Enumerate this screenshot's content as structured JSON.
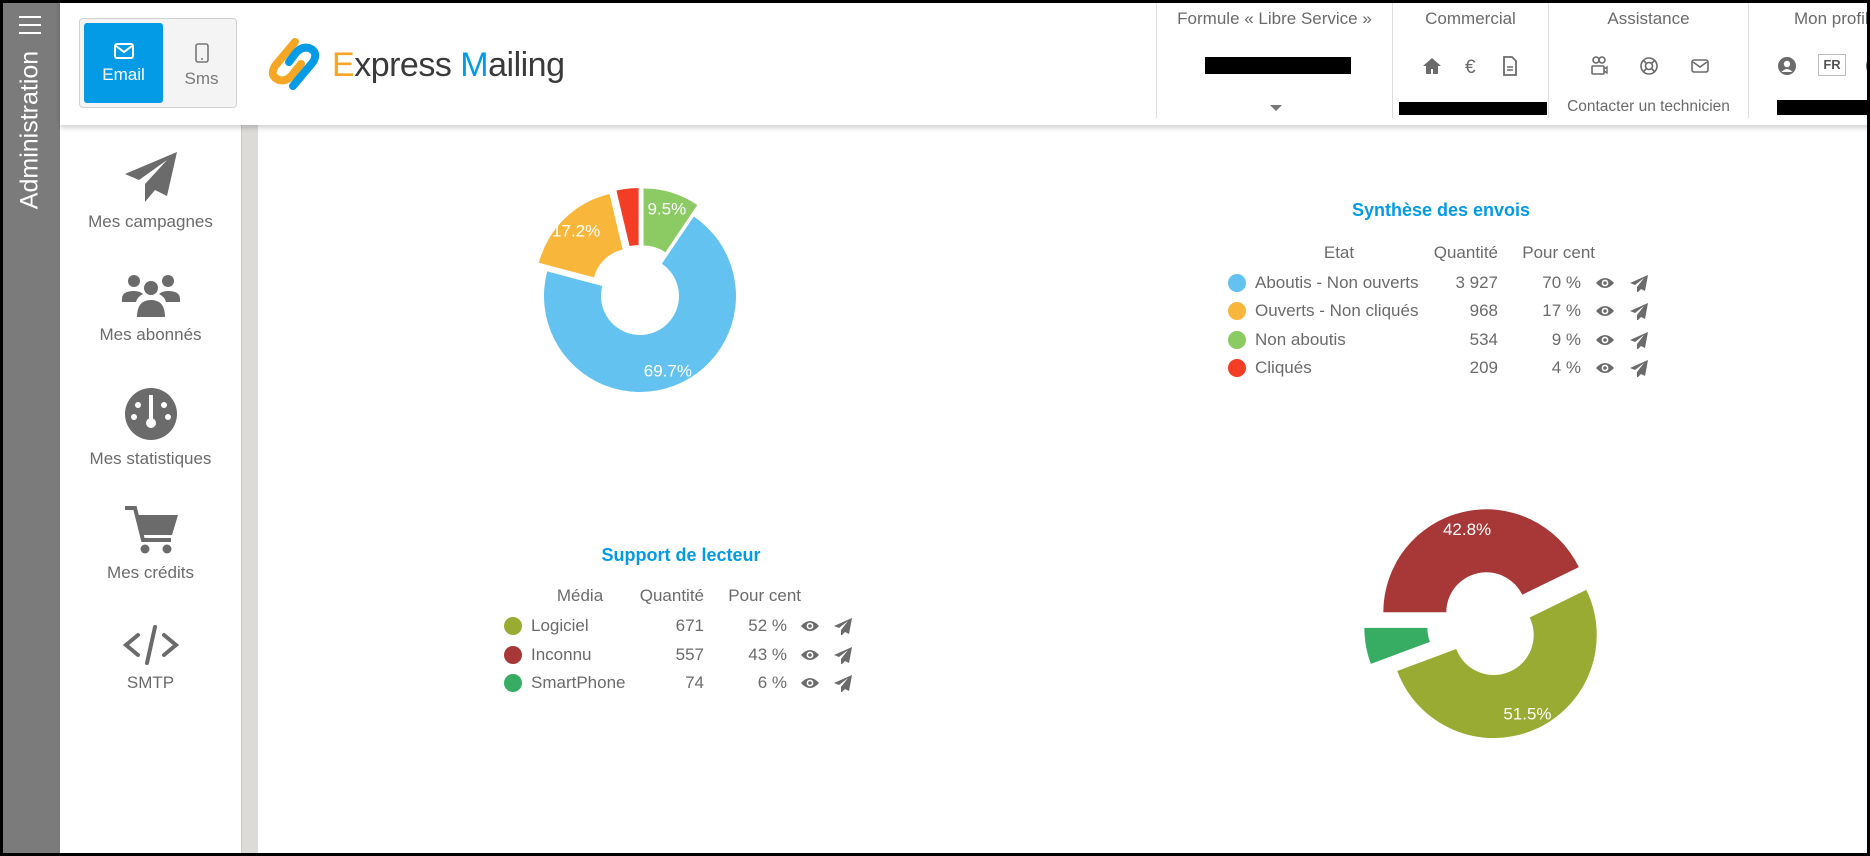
{
  "admin_bar": {
    "label": "Administration",
    "menu_icon": "hamburger-icon"
  },
  "channel_toggle": {
    "email": "Email",
    "sms": "Sms",
    "active": "Email",
    "accent": "#039be5"
  },
  "logo": {
    "text_part1": "E",
    "text_part2": "xpress ",
    "text_part3": "M",
    "text_part4": "ailing"
  },
  "header_nav": {
    "formule": {
      "title": "Formule « Libre Service »"
    },
    "commercial": {
      "title": "Commercial",
      "icons": [
        "home-icon",
        "euro-icon",
        "document-icon"
      ]
    },
    "assistance": {
      "title": "Assistance",
      "icons": [
        "video-call-icon",
        "lifebuoy-icon",
        "mail-icon"
      ],
      "link": "Contacter un technicien"
    },
    "profil": {
      "title": "Mon profil",
      "icons": [
        "user-circle-icon",
        "language-badge"
      ],
      "language": "FR"
    }
  },
  "sidebar": {
    "items": [
      {
        "label": "Mes campagnes",
        "icon": "paper-plane-icon"
      },
      {
        "label": "Mes abonnés",
        "icon": "users-icon"
      },
      {
        "label": "Mes statistiques",
        "icon": "dashboard-gauge-icon"
      },
      {
        "label": "Mes crédits",
        "icon": "cart-icon"
      },
      {
        "label": "SMTP",
        "icon": "code-icon"
      }
    ]
  },
  "synthese": {
    "title": "Synthèse des envois",
    "headers": [
      "Etat",
      "Quantité",
      "Pour cent"
    ],
    "rows": [
      {
        "label": "Aboutis - Non ouverts",
        "qty": "3 927",
        "pct": "70 %",
        "color": "#64c2f0"
      },
      {
        "label": "Ouverts - Non cliqués",
        "qty": "968",
        "pct": "17 %",
        "color": "#f8b73a"
      },
      {
        "label": "Non aboutis",
        "qty": "534",
        "pct": "9 %",
        "color": "#8ccb63"
      },
      {
        "label": "Cliqués",
        "qty": "209",
        "pct": "4 %",
        "color": "#f43d25"
      }
    ]
  },
  "support": {
    "title": "Support de lecteur",
    "headers": [
      "Média",
      "Quantité",
      "Pour cent"
    ],
    "rows": [
      {
        "label": "Logiciel",
        "qty": "671",
        "pct": "52 %",
        "color": "#9aab33"
      },
      {
        "label": "Inconnu",
        "qty": "557",
        "pct": "43 %",
        "color": "#a83838"
      },
      {
        "label": "SmartPhone",
        "qty": "74",
        "pct": "6 %",
        "color": "#36ad62"
      }
    ]
  },
  "chart_data": [
    {
      "type": "pie",
      "variant": "donut",
      "categories": [
        "Aboutis - Non ouverts",
        "Ouverts - Non cliqués",
        "Non aboutis",
        "Cliqués"
      ],
      "values": [
        3927,
        968,
        534,
        209
      ],
      "data_labels": [
        "69.7%",
        "17.2%",
        "9.5%",
        ""
      ],
      "colors": [
        "#64c2f0",
        "#f8b73a",
        "#8ccb63",
        "#f43d25"
      ]
    },
    {
      "type": "pie",
      "variant": "donut",
      "categories": [
        "Logiciel",
        "Inconnu",
        "SmartPhone"
      ],
      "values": [
        671,
        557,
        74
      ],
      "data_labels": [
        "51.5%",
        "42.8%",
        ""
      ],
      "colors": [
        "#9aab33",
        "#a83838",
        "#36ad62"
      ]
    }
  ]
}
